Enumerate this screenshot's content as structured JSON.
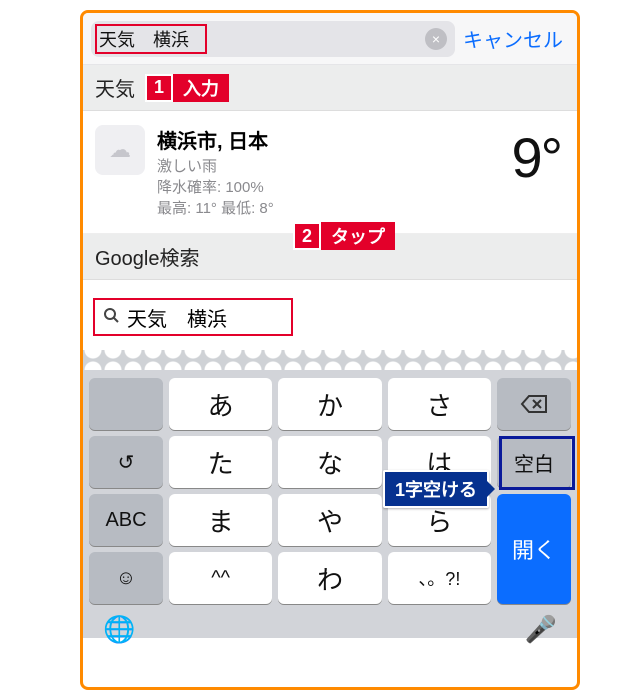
{
  "search": {
    "query": "天気　横浜",
    "cancel": "キャンセル",
    "clear_icon": "×"
  },
  "annot": {
    "step1_num": "1",
    "step1_label": "入力",
    "step2_num": "2",
    "step2_label": "タップ",
    "callout": "1字空ける"
  },
  "sections": {
    "weather": "天気",
    "google": "Google検索"
  },
  "weather": {
    "city": "横浜市, 日本",
    "cond": "激しい雨",
    "pop": "降水確率: 100%",
    "hilo": "最高: 11° 最低: 8°",
    "temp": "9°",
    "icon_glyph": "☁"
  },
  "gsearch": {
    "mag": "🔍",
    "text": "天気　横浜"
  },
  "keyboard": {
    "rows": [
      [
        "",
        "あ",
        "か",
        "さ",
        "⌫"
      ],
      [
        "↺",
        "た",
        "な",
        "は",
        "空白"
      ],
      [
        "ABC",
        "ま",
        "や",
        "ら",
        "開く"
      ],
      [
        "☺",
        "^^",
        "わ",
        "、。?!",
        ""
      ]
    ],
    "globe": "🌐",
    "mic": "🎤"
  }
}
